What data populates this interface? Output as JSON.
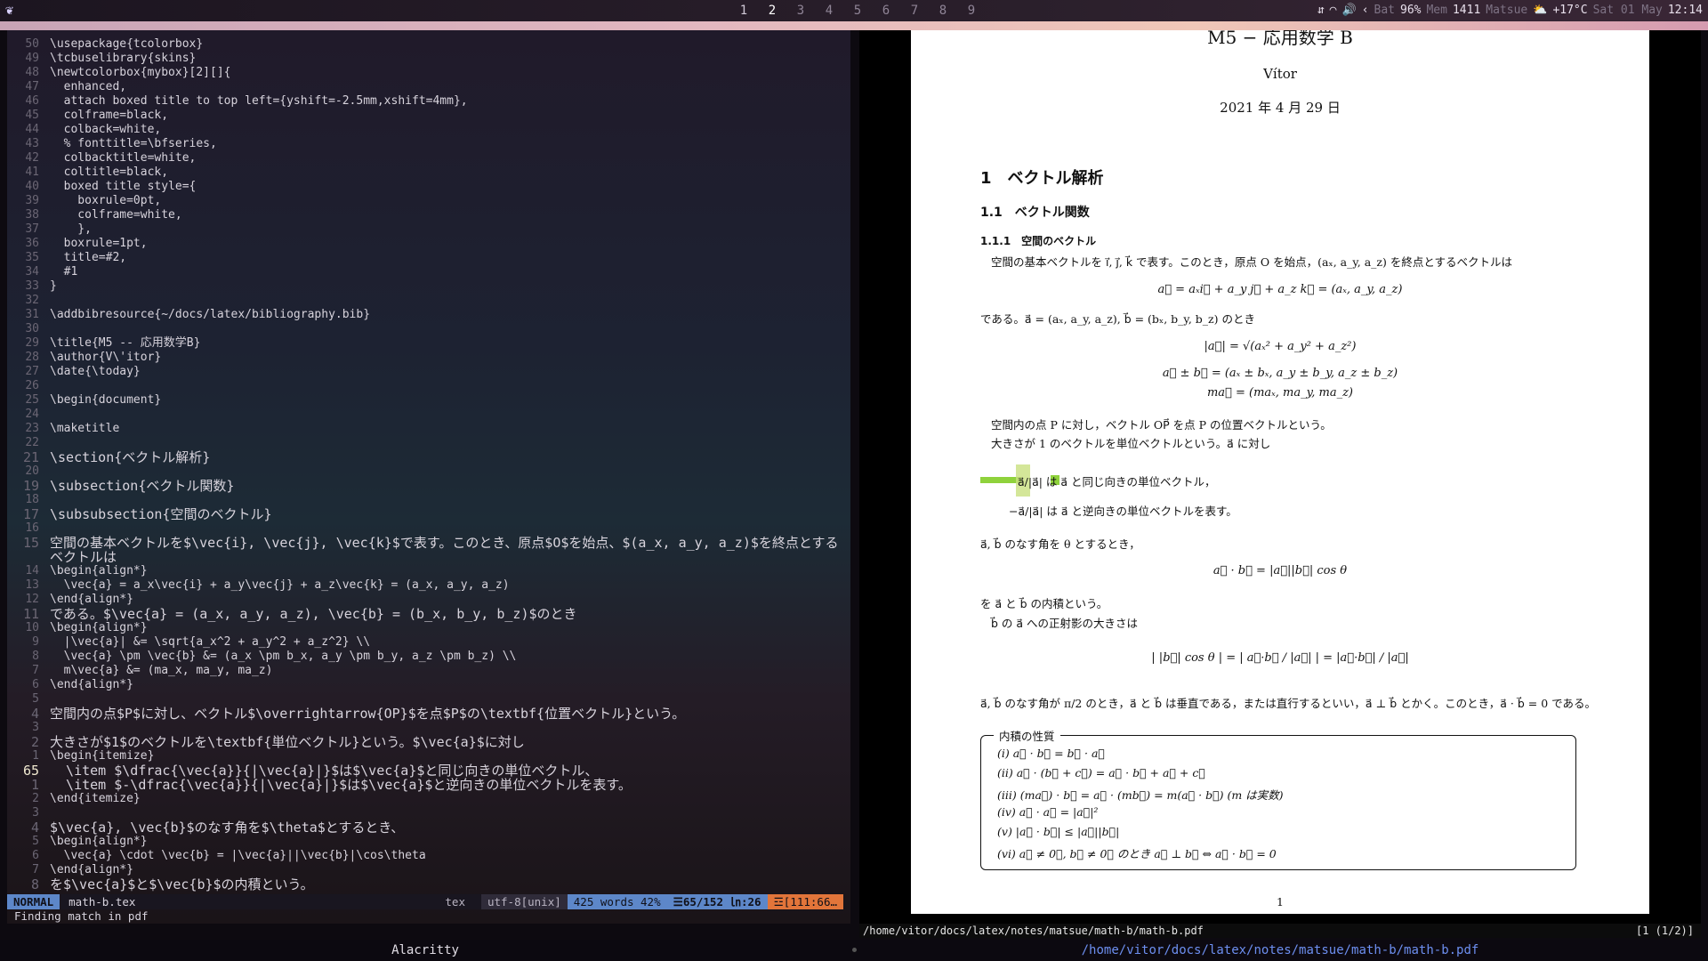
{
  "topbar": {
    "workspaces": [
      "1",
      "2",
      "3",
      "4",
      "5",
      "6",
      "7",
      "8",
      "9"
    ],
    "active_workspace": "2",
    "status": {
      "bat_label": "Bat",
      "bat_value": "96%",
      "mem_label": "Mem",
      "mem_value": "1411",
      "location": "Matsue",
      "temp": "+17°C",
      "date": "Sat 01 May",
      "time": "12:14"
    }
  },
  "editor": {
    "lines": [
      {
        "n": "50",
        "t": "\\usepackage{tcolorbox}",
        "k": "cmd"
      },
      {
        "n": "49",
        "t": "\\tcbuselibrary{skins}",
        "k": "cmd"
      },
      {
        "n": "48",
        "t": "\\newtcolorbox{mybox}[2][]{",
        "k": "cmd"
      },
      {
        "n": "47",
        "t": "  enhanced,",
        "k": "arg"
      },
      {
        "n": "46",
        "t": "  attach boxed title to top left={yshift=-2.5mm,xshift=4mm},",
        "k": "arg"
      },
      {
        "n": "45",
        "t": "  colframe=black,",
        "k": "arg"
      },
      {
        "n": "44",
        "t": "  colback=white,",
        "k": "arg"
      },
      {
        "n": "43",
        "t": "  % fonttitle=\\bfseries,",
        "k": "com"
      },
      {
        "n": "42",
        "t": "  colbacktitle=white,",
        "k": "arg"
      },
      {
        "n": "41",
        "t": "  coltitle=black,",
        "k": "arg"
      },
      {
        "n": "40",
        "t": "  boxed title style={",
        "k": "arg"
      },
      {
        "n": "39",
        "t": "    boxrule=0pt,",
        "k": "arg"
      },
      {
        "n": "38",
        "t": "    colframe=white,",
        "k": "arg"
      },
      {
        "n": "37",
        "t": "    },",
        "k": "arg"
      },
      {
        "n": "36",
        "t": "  boxrule=1pt,",
        "k": "arg"
      },
      {
        "n": "35",
        "t": "  title=#2,",
        "k": "arg"
      },
      {
        "n": "34",
        "t": "  #1",
        "k": "arg"
      },
      {
        "n": "33",
        "t": "}",
        "k": "arg"
      },
      {
        "n": "32",
        "t": "",
        "k": "arg"
      },
      {
        "n": "31",
        "t": "\\addbibresource{~/docs/latex/bibliography.bib}",
        "k": "cmd"
      },
      {
        "n": "30",
        "t": "",
        "k": "arg"
      },
      {
        "n": "29",
        "t": "\\title{M5 -- 応用数学B}",
        "k": "cmd"
      },
      {
        "n": "28",
        "t": "\\author{V\\'itor}",
        "k": "cmd"
      },
      {
        "n": "27",
        "t": "\\date{\\today}",
        "k": "cmd"
      },
      {
        "n": "26",
        "t": "",
        "k": "arg"
      },
      {
        "n": "25",
        "t": "\\begin{document}",
        "k": "cmd"
      },
      {
        "n": "24",
        "t": "",
        "k": "arg"
      },
      {
        "n": "23",
        "t": "\\maketitle",
        "k": "cmd"
      },
      {
        "n": "22",
        "t": "",
        "k": "arg"
      },
      {
        "n": "21",
        "t": "\\section{ベクトル解析}",
        "k": "jp"
      },
      {
        "n": "20",
        "t": "",
        "k": "arg"
      },
      {
        "n": "19",
        "t": "\\subsection{ベクトル関数}",
        "k": "jp"
      },
      {
        "n": "18",
        "t": "",
        "k": "arg"
      },
      {
        "n": "17",
        "t": "\\subsubsection{空間のベクトル}",
        "k": "jp"
      },
      {
        "n": "16",
        "t": "",
        "k": "arg"
      },
      {
        "n": "15",
        "t": "空間の基本ベクトルを$\\vec{i}, \\vec{j}, \\vec{k}$で表す。このとき、原点$O$を始点、$(a_x, a_y, a_z)$を終点とするベクトルは",
        "k": "big"
      },
      {
        "n": "14",
        "t": "\\begin{align*}",
        "k": "cmd"
      },
      {
        "n": "13",
        "t": "  \\vec{a} = a_x\\vec{i} + a_y\\vec{j} + a_z\\vec{k} = (a_x, a_y, a_z)",
        "k": "math"
      },
      {
        "n": "12",
        "t": "\\end{align*}",
        "k": "cmd"
      },
      {
        "n": "11",
        "t": "である。$\\vec{a} = (a_x, a_y, a_z), \\vec{b} = (b_x, b_y, b_z)$のとき",
        "k": "jptext"
      },
      {
        "n": "10",
        "t": "\\begin{align*}",
        "k": "cmd"
      },
      {
        "n": "9",
        "t": "  |\\vec{a}| &= \\sqrt{a_x^2 + a_y^2 + a_z^2} \\\\",
        "k": "math"
      },
      {
        "n": "8",
        "t": "  \\vec{a} \\pm \\vec{b} &= (a_x \\pm b_x, a_y \\pm b_y, a_z \\pm b_z) \\\\",
        "k": "math"
      },
      {
        "n": "7",
        "t": "  m\\vec{a} &= (ma_x, ma_y, ma_z)",
        "k": "math"
      },
      {
        "n": "6",
        "t": "\\end{align*}",
        "k": "cmd"
      },
      {
        "n": "5",
        "t": "",
        "k": "arg"
      },
      {
        "n": "4",
        "t": "空間内の点$P$に対し、ベクトル$\\overrightarrow{OP}$を点$P$の\\textbf{位置ベクトル}という。",
        "k": "jptext"
      },
      {
        "n": "3",
        "t": "",
        "k": "arg"
      },
      {
        "n": "2",
        "t": "大きさが$1$のベクトルを\\textbf{単位ベクトル}という。$\\vec{a}$に対し",
        "k": "jptext"
      },
      {
        "n": "1",
        "t": "\\begin{itemize}",
        "k": "cmd"
      },
      {
        "n": "65",
        "t": "  \\item $\\dfrac{\\vec{a}}{|\\vec{a}|}$は$\\vec{a}$と同じ向きの単位ベクトル、",
        "k": "cur"
      },
      {
        "n": "1",
        "t": "  \\item $-\\dfrac{\\vec{a}}{|\\vec{a}|}$は$\\vec{a}$と逆向きの単位ベクトルを表す。",
        "k": "jptext"
      },
      {
        "n": "2",
        "t": "\\end{itemize}",
        "k": "cmd"
      },
      {
        "n": "3",
        "t": "",
        "k": "arg"
      },
      {
        "n": "4",
        "t": "$\\vec{a}, \\vec{b}$のなす角を$\\theta$とするとき、",
        "k": "jptext"
      },
      {
        "n": "5",
        "t": "\\begin{align*}",
        "k": "cmd"
      },
      {
        "n": "6",
        "t": "  \\vec{a} \\cdot \\vec{b} = |\\vec{a}||\\vec{b}|\\cos\\theta",
        "k": "math"
      },
      {
        "n": "7",
        "t": "\\end{align*}",
        "k": "cmd"
      },
      {
        "n": "8",
        "t": "を$\\vec{a}$と$\\vec{b}$の内積という。",
        "k": "jptext"
      }
    ],
    "statusline": {
      "mode": "NORMAL",
      "filename": "math-b.tex",
      "filetype": "tex",
      "encoding": "utf-8[unix]",
      "words": "425 words 42%",
      "position": "☰65/152 ㏑:26",
      "warning": "☲[111:66…"
    },
    "cmdline": "Finding match in pdf"
  },
  "pdf": {
    "doc_title": "M5 − 応用数学 B",
    "author": "Vítor",
    "date": "2021 年 4 月 29 日",
    "section": "1　ベクトル解析",
    "subsection": "1.1　ベクトル関数",
    "subsubsection": "1.1.1　空間のベクトル",
    "para1": "空間の基本ベクトルを i⃗, j⃗, k⃗ で表す。このとき，原点 O を始点，(aₓ, a_y, a_z) を終点とするベクトルは",
    "eq1": "a⃗ = aₓi⃗ + a_y j⃗ + a_z k⃗ = (aₓ, a_y, a_z)",
    "para2": "である。a⃗ = (aₓ, a_y, a_z), b⃗ = (bₓ, b_y, b_z) のとき",
    "eq2": "|a⃗| = √(aₓ² + a_y² + a_z²)",
    "eq3": "a⃗ ± b⃗ = (aₓ ± bₓ, a_y ± b_y, a_z ± b_z)",
    "eq4": "ma⃗ = (maₓ, ma_y, ma_z)",
    "para3": "空間内の点 P に対し，ベクトル OP⃗ を点 P の位置ベクトルという。",
    "para4": "大きさが 1 のベクトルを単位ベクトルという。a⃗ に対し",
    "bullet1": "a⃗/|a⃗| は a⃗ と同じ向きの単位ベクトル，",
    "bullet2": "−a⃗/|a⃗| は a⃗ と逆向きの単位ベクトルを表す。",
    "para5": "a⃗, b⃗ のなす角を θ とするとき，",
    "eq5": "a⃗ · b⃗ = |a⃗||b⃗| cos θ",
    "para6": "を a⃗ と b⃗ の内積という。",
    "para7": "b⃗ の a⃗ への正射影の大きさは",
    "eq6": "| |b⃗| cos θ | = | a⃗·b⃗ / |a⃗| | = |a⃗·b⃗| / |a⃗|",
    "para8": "a⃗, b⃗ のなす角が π/2 のとき，a⃗ と b⃗ は垂直である，または直行するといい，a⃗ ⊥ b⃗ とかく。このとき，a⃗ · b⃗ = 0 である。",
    "box_title": "内積の性質",
    "properties": [
      "(i)  a⃗ · b⃗ = b⃗ · a⃗",
      "(ii)  a⃗ · (b⃗ + c⃗) = a⃗ · b⃗ + a⃗ + c⃗",
      "(iii)  (ma⃗) · b⃗ = a⃗ · (mb⃗) = m(a⃗ · b⃗)  (m は実数)",
      "(iv)  a⃗ · a⃗ = |a⃗|²",
      "(v)  |a⃗ · b⃗| ≤ |a⃗||b⃗|",
      "(vi)  a⃗ ≠ 0⃗, b⃗ ≠ 0⃗ のとき a⃗ ⊥ b⃗ ⇔ a⃗ · b⃗ = 0"
    ],
    "page_number": "1"
  },
  "zathura": {
    "path": "/home/vitor/docs/latex/notes/matsue/math-b/math-b.pdf",
    "page": "[1 (1/2)]"
  },
  "bottombar": {
    "left_title": "Alacritty",
    "right_title": "/home/vitor/docs/latex/notes/matsue/math-b/math-b.pdf"
  }
}
